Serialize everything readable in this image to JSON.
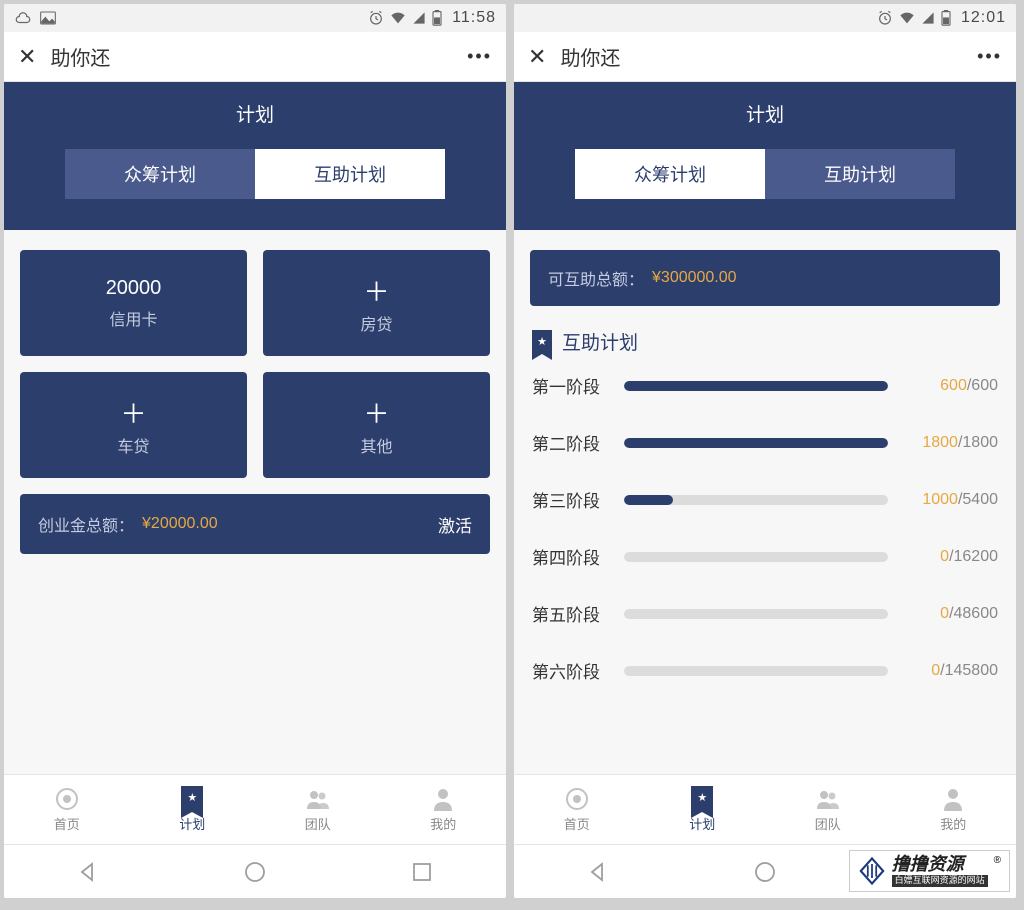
{
  "left": {
    "status_time": "11:58",
    "app_title": "助你还",
    "header_title": "计划",
    "tab_crowd": "众筹计划",
    "tab_mutual": "互助计划",
    "cards": {
      "credit_value": "20000",
      "credit_label": "信用卡",
      "mortgage_label": "房贷",
      "car_label": "车贷",
      "other_label": "其他"
    },
    "summary_label": "创业金总额：",
    "summary_value": "¥20000.00",
    "summary_action": "激活"
  },
  "right": {
    "status_time": "12:01",
    "app_title": "助你还",
    "header_title": "计划",
    "tab_crowd": "众筹计划",
    "tab_mutual": "互助计划",
    "info_label": "可互助总额：",
    "info_value": "¥300000.00",
    "section_title": "互助计划",
    "stages": [
      {
        "label": "第一阶段",
        "cur": "600",
        "max": "600",
        "pct": 100
      },
      {
        "label": "第二阶段",
        "cur": "1800",
        "max": "1800",
        "pct": 100
      },
      {
        "label": "第三阶段",
        "cur": "1000",
        "max": "5400",
        "pct": 18.5
      },
      {
        "label": "第四阶段",
        "cur": "0",
        "max": "16200",
        "pct": 0
      },
      {
        "label": "第五阶段",
        "cur": "0",
        "max": "48600",
        "pct": 0
      },
      {
        "label": "第六阶段",
        "cur": "0",
        "max": "145800",
        "pct": 0
      }
    ]
  },
  "nav": {
    "home": "首页",
    "plan": "计划",
    "team": "团队",
    "mine": "我的"
  },
  "watermark": {
    "big": "撸撸资源",
    "small": "白嫖互联网资源的网站"
  }
}
